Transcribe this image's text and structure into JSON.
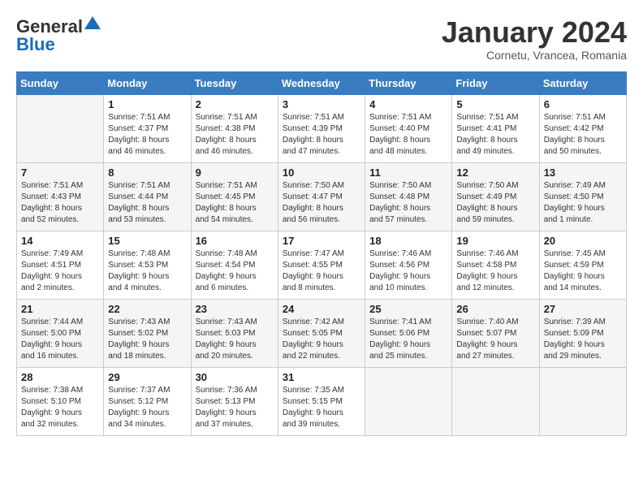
{
  "header": {
    "logo_general": "General",
    "logo_blue": "Blue",
    "month_title": "January 2024",
    "location": "Cornetu, Vrancea, Romania"
  },
  "days_of_week": [
    "Sunday",
    "Monday",
    "Tuesday",
    "Wednesday",
    "Thursday",
    "Friday",
    "Saturday"
  ],
  "weeks": [
    [
      {
        "day": "",
        "info": ""
      },
      {
        "day": "1",
        "info": "Sunrise: 7:51 AM\nSunset: 4:37 PM\nDaylight: 8 hours\nand 46 minutes."
      },
      {
        "day": "2",
        "info": "Sunrise: 7:51 AM\nSunset: 4:38 PM\nDaylight: 8 hours\nand 46 minutes."
      },
      {
        "day": "3",
        "info": "Sunrise: 7:51 AM\nSunset: 4:39 PM\nDaylight: 8 hours\nand 47 minutes."
      },
      {
        "day": "4",
        "info": "Sunrise: 7:51 AM\nSunset: 4:40 PM\nDaylight: 8 hours\nand 48 minutes."
      },
      {
        "day": "5",
        "info": "Sunrise: 7:51 AM\nSunset: 4:41 PM\nDaylight: 8 hours\nand 49 minutes."
      },
      {
        "day": "6",
        "info": "Sunrise: 7:51 AM\nSunset: 4:42 PM\nDaylight: 8 hours\nand 50 minutes."
      }
    ],
    [
      {
        "day": "7",
        "info": "Sunrise: 7:51 AM\nSunset: 4:43 PM\nDaylight: 8 hours\nand 52 minutes."
      },
      {
        "day": "8",
        "info": "Sunrise: 7:51 AM\nSunset: 4:44 PM\nDaylight: 8 hours\nand 53 minutes."
      },
      {
        "day": "9",
        "info": "Sunrise: 7:51 AM\nSunset: 4:45 PM\nDaylight: 8 hours\nand 54 minutes."
      },
      {
        "day": "10",
        "info": "Sunrise: 7:50 AM\nSunset: 4:47 PM\nDaylight: 8 hours\nand 56 minutes."
      },
      {
        "day": "11",
        "info": "Sunrise: 7:50 AM\nSunset: 4:48 PM\nDaylight: 8 hours\nand 57 minutes."
      },
      {
        "day": "12",
        "info": "Sunrise: 7:50 AM\nSunset: 4:49 PM\nDaylight: 8 hours\nand 59 minutes."
      },
      {
        "day": "13",
        "info": "Sunrise: 7:49 AM\nSunset: 4:50 PM\nDaylight: 9 hours\nand 1 minute."
      }
    ],
    [
      {
        "day": "14",
        "info": "Sunrise: 7:49 AM\nSunset: 4:51 PM\nDaylight: 9 hours\nand 2 minutes."
      },
      {
        "day": "15",
        "info": "Sunrise: 7:48 AM\nSunset: 4:53 PM\nDaylight: 9 hours\nand 4 minutes."
      },
      {
        "day": "16",
        "info": "Sunrise: 7:48 AM\nSunset: 4:54 PM\nDaylight: 9 hours\nand 6 minutes."
      },
      {
        "day": "17",
        "info": "Sunrise: 7:47 AM\nSunset: 4:55 PM\nDaylight: 9 hours\nand 8 minutes."
      },
      {
        "day": "18",
        "info": "Sunrise: 7:46 AM\nSunset: 4:56 PM\nDaylight: 9 hours\nand 10 minutes."
      },
      {
        "day": "19",
        "info": "Sunrise: 7:46 AM\nSunset: 4:58 PM\nDaylight: 9 hours\nand 12 minutes."
      },
      {
        "day": "20",
        "info": "Sunrise: 7:45 AM\nSunset: 4:59 PM\nDaylight: 9 hours\nand 14 minutes."
      }
    ],
    [
      {
        "day": "21",
        "info": "Sunrise: 7:44 AM\nSunset: 5:00 PM\nDaylight: 9 hours\nand 16 minutes."
      },
      {
        "day": "22",
        "info": "Sunrise: 7:43 AM\nSunset: 5:02 PM\nDaylight: 9 hours\nand 18 minutes."
      },
      {
        "day": "23",
        "info": "Sunrise: 7:43 AM\nSunset: 5:03 PM\nDaylight: 9 hours\nand 20 minutes."
      },
      {
        "day": "24",
        "info": "Sunrise: 7:42 AM\nSunset: 5:05 PM\nDaylight: 9 hours\nand 22 minutes."
      },
      {
        "day": "25",
        "info": "Sunrise: 7:41 AM\nSunset: 5:06 PM\nDaylight: 9 hours\nand 25 minutes."
      },
      {
        "day": "26",
        "info": "Sunrise: 7:40 AM\nSunset: 5:07 PM\nDaylight: 9 hours\nand 27 minutes."
      },
      {
        "day": "27",
        "info": "Sunrise: 7:39 AM\nSunset: 5:09 PM\nDaylight: 9 hours\nand 29 minutes."
      }
    ],
    [
      {
        "day": "28",
        "info": "Sunrise: 7:38 AM\nSunset: 5:10 PM\nDaylight: 9 hours\nand 32 minutes."
      },
      {
        "day": "29",
        "info": "Sunrise: 7:37 AM\nSunset: 5:12 PM\nDaylight: 9 hours\nand 34 minutes."
      },
      {
        "day": "30",
        "info": "Sunrise: 7:36 AM\nSunset: 5:13 PM\nDaylight: 9 hours\nand 37 minutes."
      },
      {
        "day": "31",
        "info": "Sunrise: 7:35 AM\nSunset: 5:15 PM\nDaylight: 9 hours\nand 39 minutes."
      },
      {
        "day": "",
        "info": ""
      },
      {
        "day": "",
        "info": ""
      },
      {
        "day": "",
        "info": ""
      }
    ]
  ]
}
